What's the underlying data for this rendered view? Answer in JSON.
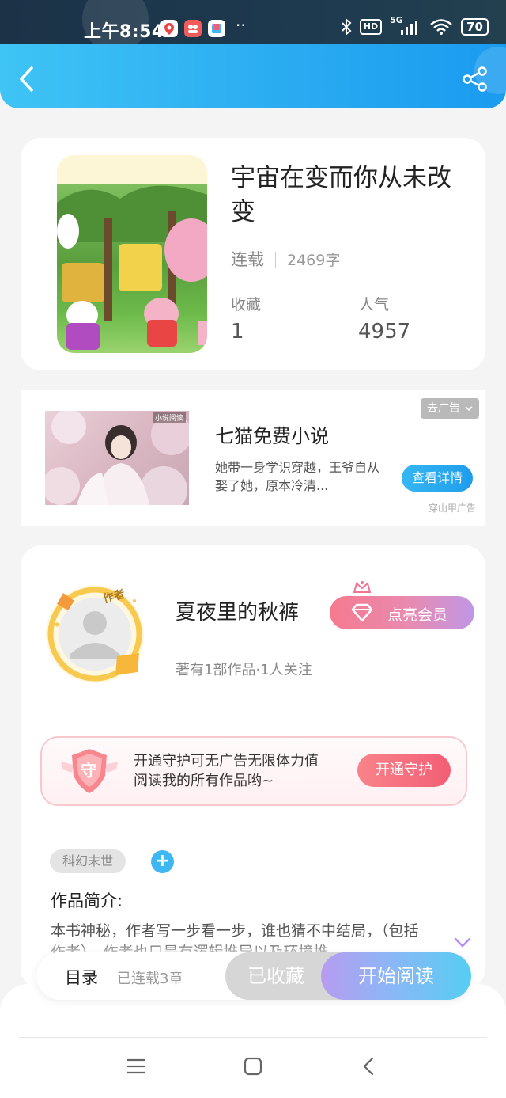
{
  "status_bar": {
    "time": "上午8:54",
    "dots": "··",
    "network": "5G",
    "hd": "HD",
    "battery": "70"
  },
  "top_bar": {
    "back_icon": "chevron-left-icon",
    "share_icon": "share-icon"
  },
  "book": {
    "title": "宇宙在变而你从未改变",
    "status": "连载",
    "word_count": "2469字",
    "favorites_label": "收藏",
    "favorites_value": "1",
    "popularity_label": "人气",
    "popularity_value": "4957"
  },
  "ad": {
    "title": "七猫免费小说",
    "description": "她带一身学识穿越，王爷自从娶了她，原本冷清...",
    "close_label": "去广告",
    "detail_button": "查看详情",
    "source": "穿山甲广告",
    "image_caption": "小说阅读"
  },
  "author": {
    "badge": "作者",
    "name": "夏夜里的秋裤",
    "stats": "著有1部作品·1人关注",
    "vip_button": "点亮会员"
  },
  "guard": {
    "badge": "守",
    "line1": "开通守护可无广告无限体力值",
    "line2": "阅读我的所有作品哟~",
    "button": "开通守护"
  },
  "genre_tag": "科幻末世",
  "intro": {
    "label": "作品简介:",
    "text": "本书神秘，作者写一步看一步，谁也猜不中结局，（包括作者）。作者也只是有逻辑推导以及环境推"
  },
  "bottom_bar": {
    "toc_label": "目录",
    "toc_status": "已连载3章",
    "favorited_button": "已收藏",
    "start_reading_button": "开始阅读"
  },
  "nav_bar": {
    "menu_icon": "menu-icon",
    "home_icon": "home-icon",
    "back_icon": "back-icon"
  },
  "colors": {
    "accent_blue": "#29aaf1",
    "vip_pink": "#f57a8e",
    "guard_red": "#f25e75",
    "read_gradient_end": "#56cdf2"
  }
}
